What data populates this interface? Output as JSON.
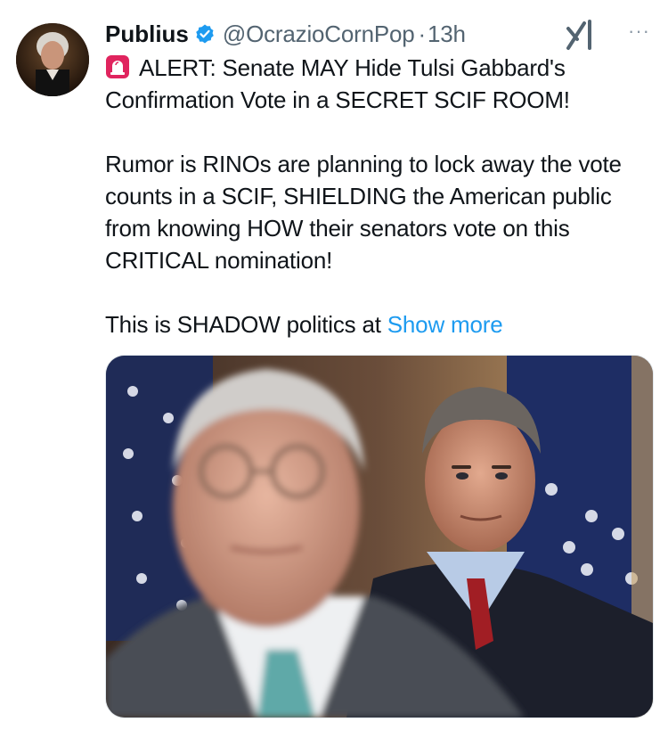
{
  "post": {
    "author_name": "Publius",
    "author_handle": "@OcrazioCornPop",
    "separator": "·",
    "time": "13h",
    "more_label": "···",
    "text_line1": "ALERT:  Senate MAY Hide Tulsi Gabbard's Confirmation Vote in a SECRET SCIF ROOM!",
    "text_para2": "Rumor is RINOs are planning to lock away the vote counts in a SCIF, SHIELDING the American public from knowing HOW their senators vote on this CRITICAL nomination!",
    "text_para3": "This is SHADOW politics at",
    "show_more": "Show more"
  },
  "icons": {
    "verified": "verified-badge-icon",
    "grok": "grok-icon",
    "alert": "police-light-emoji",
    "more": "more-options-icon"
  },
  "colors": {
    "link": "#1d9bf0",
    "verified": "#1d9bf0",
    "secondary_text": "#536471"
  }
}
